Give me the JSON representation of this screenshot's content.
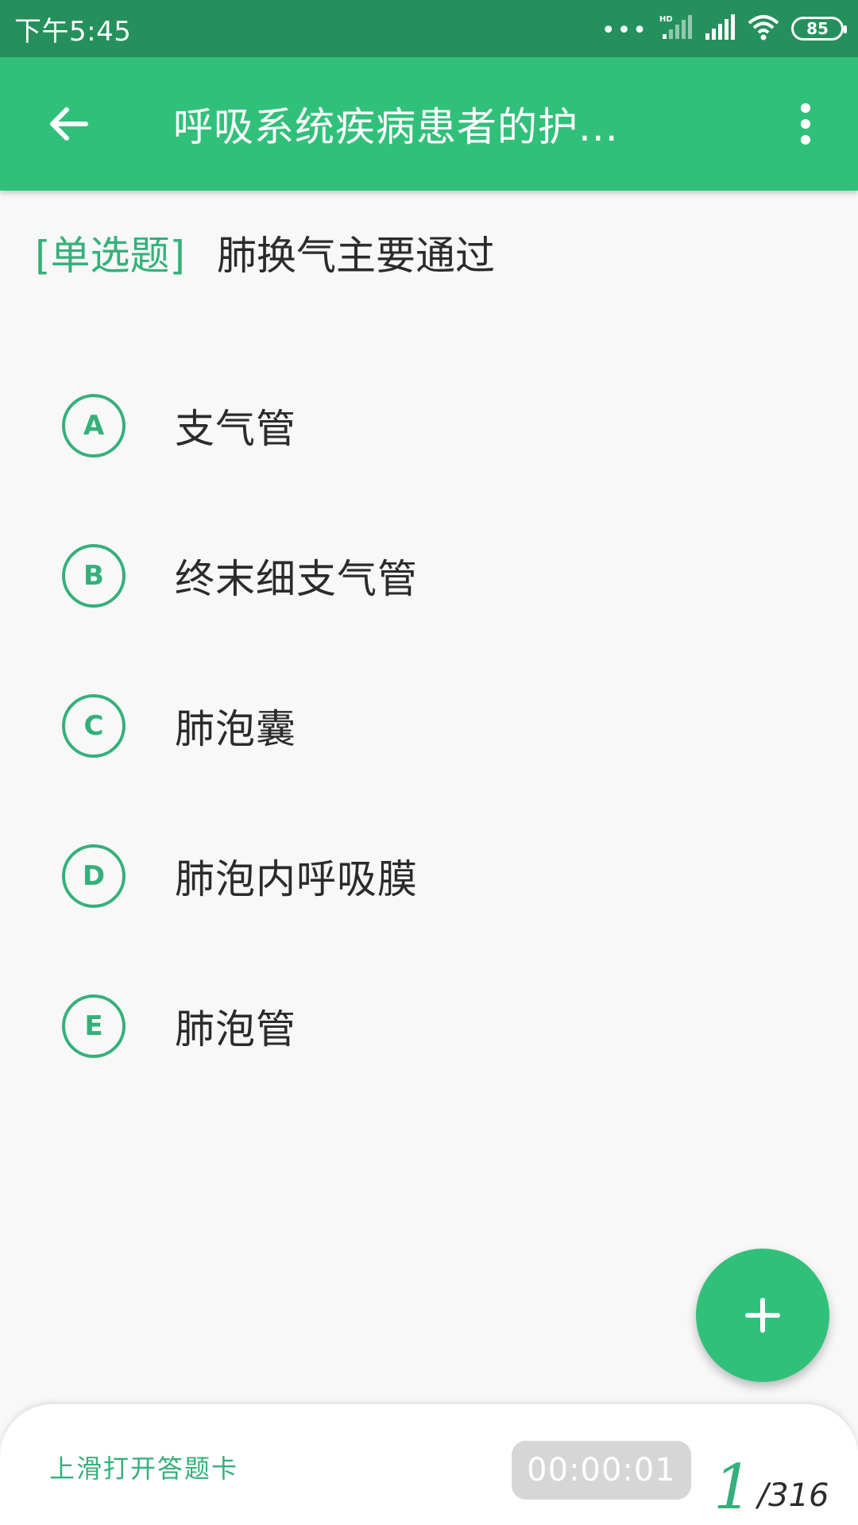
{
  "status_bar": {
    "time": "下午5:45",
    "battery": "85",
    "icons": [
      "more-dots-icon",
      "hd-signal-icon",
      "signal-icon",
      "wifi-icon",
      "battery-icon"
    ]
  },
  "app_bar": {
    "title": "呼吸系统疾病患者的护...",
    "back_icon": "arrow-left-icon",
    "more_icon": "more-vert-icon"
  },
  "question": {
    "type": "[单选题]",
    "text": "肺换气主要通过"
  },
  "options": [
    {
      "letter": "A",
      "text": "支气管"
    },
    {
      "letter": "B",
      "text": "终末细支气管"
    },
    {
      "letter": "C",
      "text": "肺泡囊"
    },
    {
      "letter": "D",
      "text": "肺泡内呼吸膜"
    },
    {
      "letter": "E",
      "text": "肺泡管"
    }
  ],
  "fab": {
    "icon": "plus-icon"
  },
  "bottom_sheet": {
    "hint": "上滑打开答题卡",
    "timer": "00:00:01",
    "current": "1",
    "total": "/316"
  },
  "colors": {
    "status_bar": "#25905c",
    "primary": "#31c07a",
    "accent_text": "#35b07a",
    "timer_bg": "#d6d6d6"
  }
}
